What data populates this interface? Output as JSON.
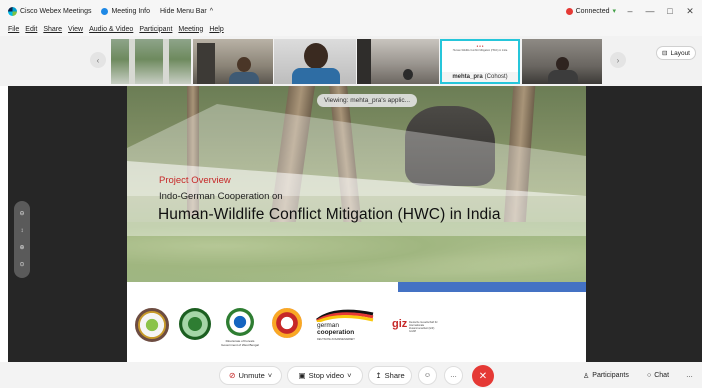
{
  "titlebar": {
    "app_name": "Cisco Webex Meetings",
    "meeting_info": "Meeting Info",
    "hide_menu": "Hide Menu Bar",
    "hide_menu_chevron": "^",
    "status": "Connected",
    "status_chevron": "▾",
    "window_controls": [
      "–",
      "—",
      "□",
      "✕"
    ]
  },
  "menubar": {
    "items": [
      "File",
      "Edit",
      "Share",
      "View",
      "Audio & Video",
      "Participant",
      "Meeting",
      "Help"
    ]
  },
  "strip": {
    "prev_arrow": "‹",
    "next_arrow": "›",
    "layout_label": "Layout",
    "layout_icon": "⊟",
    "host_name": "mehta_pra",
    "host_role": "(Cohost)"
  },
  "slide": {
    "viewing_label": "Viewing: mehta_pra's applic...",
    "eyebrow": "Project Overview",
    "subtitle": "Indo-German Cooperation on",
    "title": "Human-Wildlife Conflict Mitigation (HWC) in India",
    "logo_wb_caption": "Directorate of Forests Government of West Bengal",
    "german_line1": "german",
    "german_line2": "cooperation",
    "german_tiny": "DEUTSCHE ZUSAMMENARBEIT",
    "giz_label": "giz",
    "giz_sub": "Deutsche Gesellschaft für Internationale Zusammenarbeit (GIZ) GmbH"
  },
  "zoombar": {
    "icons": [
      "⊖",
      "↕",
      "⊕",
      "⊙"
    ]
  },
  "controls": {
    "unmute_label": "Unmute",
    "unmute_icon": "⊘",
    "chevron": "˅",
    "stop_video_label": "Stop video",
    "video_icon": "▣",
    "share_label": "Share",
    "share_icon": "↥",
    "reaction_icon": "☺",
    "more_icon": "…",
    "end_icon": "✕",
    "participants_label": "Participants",
    "participants_icon": "♙",
    "chat_label": "Chat",
    "chat_icon": "○",
    "overflow_icon": "…"
  },
  "colors": {
    "accent_red": "#e53935",
    "title_red": "#c62828",
    "selected_tile": "#26c6da",
    "slide_blue": "#4472c4"
  }
}
